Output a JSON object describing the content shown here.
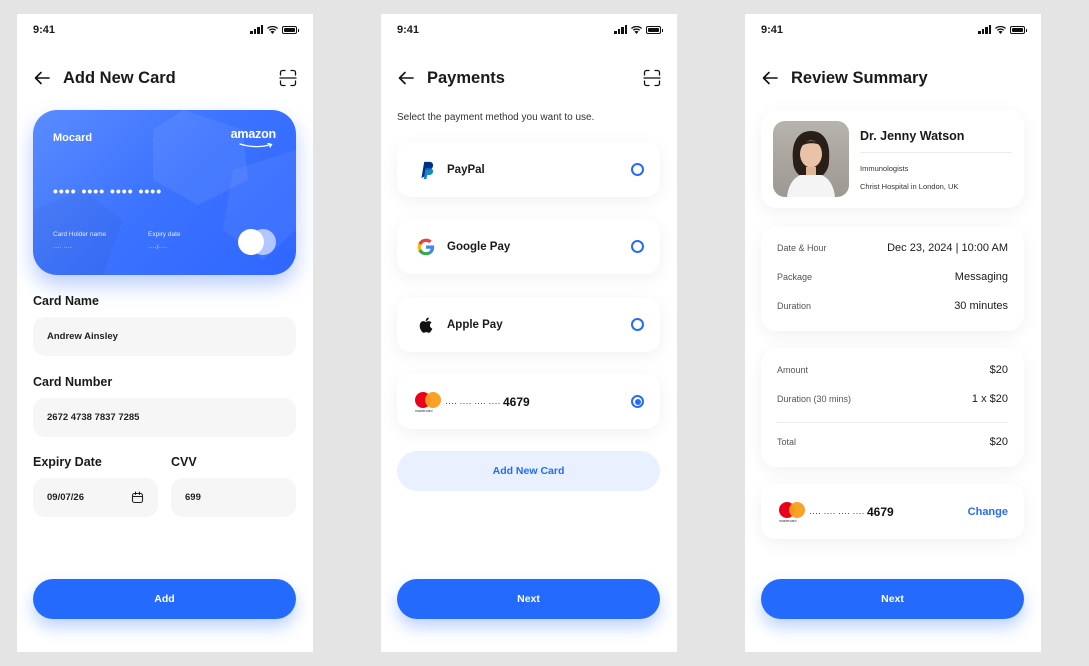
{
  "theme": {
    "primary": "#246bfd",
    "primary_light": "#e9f0ff",
    "card_blue": "#3b72ff",
    "background": "#e4e4e4"
  },
  "status_bar": {
    "time": "9:41"
  },
  "screen1": {
    "title": "Add New Card",
    "card": {
      "brand": "Mocard",
      "issuer": "amazon",
      "masked_number": "•••• •••• •••• ••••",
      "holder_label": "Card Holder name",
      "holder_value": "···· ····",
      "expiry_label": "Expiry date",
      "expiry_value": "····/····"
    },
    "card_name_label": "Card Name",
    "card_name_value": "Andrew Ainsley",
    "card_number_label": "Card Number",
    "card_number_value": "2672 4738 7837 7285",
    "expiry_label": "Expiry Date",
    "expiry_value": "09/07/26",
    "cvv_label": "CVV",
    "cvv_value": "699",
    "add_button": "Add"
  },
  "screen2": {
    "title": "Payments",
    "subtitle": "Select the payment method you want to use.",
    "methods": [
      {
        "name": "PayPal",
        "icon": "paypal-icon",
        "selected": false
      },
      {
        "name": "Google Pay",
        "icon": "google-icon",
        "selected": false
      },
      {
        "name": "Apple Pay",
        "icon": "apple-icon",
        "selected": false
      }
    ],
    "card_method": {
      "masked": "···· ···· ···· ····",
      "last4": "4679",
      "brand_text": "mastercard",
      "selected": true
    },
    "add_card_button": "Add New Card",
    "next_button": "Next"
  },
  "screen3": {
    "title": "Review Summary",
    "doctor": {
      "name": "Dr. Jenny Watson",
      "specialty": "Immunologists",
      "hospital": "Christ Hospital in London, UK"
    },
    "appointment": [
      {
        "key": "Date & Hour",
        "value": "Dec 23, 2024 | 10:00 AM"
      },
      {
        "key": "Package",
        "value": "Messaging"
      },
      {
        "key": "Duration",
        "value": "30 minutes"
      }
    ],
    "billing": {
      "amount_label": "Amount",
      "amount_value": "$20",
      "duration_label": "Duration (30 mins)",
      "duration_value": "1 x $20",
      "total_label": "Total",
      "total_value": "$20"
    },
    "payment": {
      "masked": "···· ···· ···· ····",
      "last4": "4679",
      "brand_text": "mastercard",
      "change": "Change"
    },
    "next_button": "Next"
  }
}
